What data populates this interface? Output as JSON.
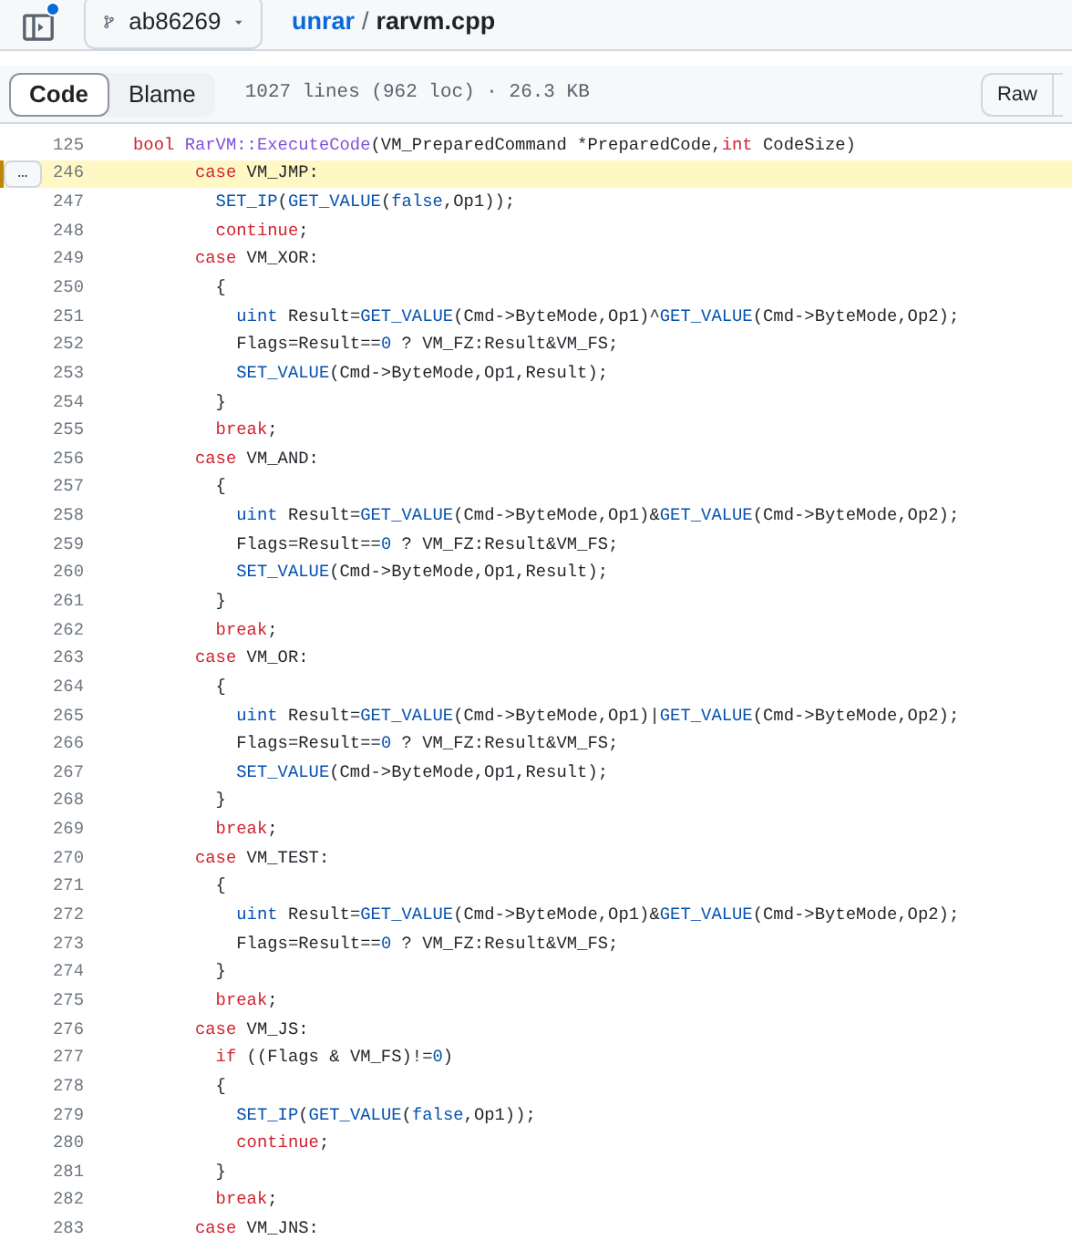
{
  "header": {
    "branch": "ab86269",
    "repo": "unrar",
    "separator": "/",
    "file": "rarvm.cpp",
    "notification": true
  },
  "toolbar": {
    "tabs": [
      {
        "label": "Code",
        "selected": true
      },
      {
        "label": "Blame",
        "selected": false
      }
    ],
    "info": "1027 lines (962 loc) · 26.3 KB",
    "raw_button": "Raw"
  },
  "code": {
    "lines": [
      {
        "number": "125",
        "highlighted": false,
        "tokens": [
          {
            "text": "bool",
            "kind": "keyword"
          },
          {
            "text": " RarVM::ExecuteCode",
            "kind": "entity"
          },
          {
            "text": "(VM_PreparedCommand *PreparedCode,",
            "kind": "plain"
          },
          {
            "text": "int",
            "kind": "keyword"
          },
          {
            "text": " CodeSize)",
            "kind": "plain"
          }
        ]
      },
      {
        "number": "246",
        "highlighted": true,
        "more_button": "…",
        "tokens": [
          {
            "text": "      case",
            "kind": "keyword"
          },
          {
            "text": " VM_JMP:",
            "kind": "plain"
          }
        ]
      },
      {
        "number": "247",
        "highlighted": false,
        "tokens": [
          {
            "text": "        SET_IP",
            "kind": "function"
          },
          {
            "text": "(",
            "kind": "plain"
          },
          {
            "text": "GET_VALUE",
            "kind": "function"
          },
          {
            "text": "(",
            "kind": "plain"
          },
          {
            "text": "false",
            "kind": "constant"
          },
          {
            "text": ",Op1));",
            "kind": "plain"
          }
        ]
      },
      {
        "number": "248",
        "highlighted": false,
        "tokens": [
          {
            "text": "        continue",
            "kind": "keyword"
          },
          {
            "text": ";",
            "kind": "plain"
          }
        ]
      },
      {
        "number": "249",
        "highlighted": false,
        "tokens": [
          {
            "text": "      case",
            "kind": "keyword"
          },
          {
            "text": " VM_XOR:",
            "kind": "plain"
          }
        ]
      },
      {
        "number": "250",
        "highlighted": false,
        "tokens": [
          {
            "text": "        {",
            "kind": "plain"
          }
        ]
      },
      {
        "number": "251",
        "highlighted": false,
        "tokens": [
          {
            "text": "          uint",
            "kind": "function"
          },
          {
            "text": " Result=",
            "kind": "plain"
          },
          {
            "text": "GET_VALUE",
            "kind": "function"
          },
          {
            "text": "(Cmd->ByteMode,Op1)^",
            "kind": "plain"
          },
          {
            "text": "GET_VALUE",
            "kind": "function"
          },
          {
            "text": "(Cmd->ByteMode,Op2);",
            "kind": "plain"
          }
        ]
      },
      {
        "number": "252",
        "highlighted": false,
        "tokens": [
          {
            "text": "          Flags=Result==",
            "kind": "plain"
          },
          {
            "text": "0",
            "kind": "constant"
          },
          {
            "text": " ? VM_FZ:Result&VM_FS;",
            "kind": "plain"
          }
        ]
      },
      {
        "number": "253",
        "highlighted": false,
        "tokens": [
          {
            "text": "          SET_VALUE",
            "kind": "function"
          },
          {
            "text": "(Cmd->ByteMode,Op1,Result);",
            "kind": "plain"
          }
        ]
      },
      {
        "number": "254",
        "highlighted": false,
        "tokens": [
          {
            "text": "        }",
            "kind": "plain"
          }
        ]
      },
      {
        "number": "255",
        "highlighted": false,
        "tokens": [
          {
            "text": "        break",
            "kind": "keyword"
          },
          {
            "text": ";",
            "kind": "plain"
          }
        ]
      },
      {
        "number": "256",
        "highlighted": false,
        "tokens": [
          {
            "text": "      case",
            "kind": "keyword"
          },
          {
            "text": " VM_AND:",
            "kind": "plain"
          }
        ]
      },
      {
        "number": "257",
        "highlighted": false,
        "tokens": [
          {
            "text": "        {",
            "kind": "plain"
          }
        ]
      },
      {
        "number": "258",
        "highlighted": false,
        "tokens": [
          {
            "text": "          uint",
            "kind": "function"
          },
          {
            "text": " Result=",
            "kind": "plain"
          },
          {
            "text": "GET_VALUE",
            "kind": "function"
          },
          {
            "text": "(Cmd->ByteMode,Op1)&",
            "kind": "plain"
          },
          {
            "text": "GET_VALUE",
            "kind": "function"
          },
          {
            "text": "(Cmd->ByteMode,Op2);",
            "kind": "plain"
          }
        ]
      },
      {
        "number": "259",
        "highlighted": false,
        "tokens": [
          {
            "text": "          Flags=Result==",
            "kind": "plain"
          },
          {
            "text": "0",
            "kind": "constant"
          },
          {
            "text": " ? VM_FZ:Result&VM_FS;",
            "kind": "plain"
          }
        ]
      },
      {
        "number": "260",
        "highlighted": false,
        "tokens": [
          {
            "text": "          SET_VALUE",
            "kind": "function"
          },
          {
            "text": "(Cmd->ByteMode,Op1,Result);",
            "kind": "plain"
          }
        ]
      },
      {
        "number": "261",
        "highlighted": false,
        "tokens": [
          {
            "text": "        }",
            "kind": "plain"
          }
        ]
      },
      {
        "number": "262",
        "highlighted": false,
        "tokens": [
          {
            "text": "        break",
            "kind": "keyword"
          },
          {
            "text": ";",
            "kind": "plain"
          }
        ]
      },
      {
        "number": "263",
        "highlighted": false,
        "tokens": [
          {
            "text": "      case",
            "kind": "keyword"
          },
          {
            "text": " VM_OR:",
            "kind": "plain"
          }
        ]
      },
      {
        "number": "264",
        "highlighted": false,
        "tokens": [
          {
            "text": "        {",
            "kind": "plain"
          }
        ]
      },
      {
        "number": "265",
        "highlighted": false,
        "tokens": [
          {
            "text": "          uint",
            "kind": "function"
          },
          {
            "text": " Result=",
            "kind": "plain"
          },
          {
            "text": "GET_VALUE",
            "kind": "function"
          },
          {
            "text": "(Cmd->ByteMode,Op1)|",
            "kind": "plain"
          },
          {
            "text": "GET_VALUE",
            "kind": "function"
          },
          {
            "text": "(Cmd->ByteMode,Op2);",
            "kind": "plain"
          }
        ]
      },
      {
        "number": "266",
        "highlighted": false,
        "tokens": [
          {
            "text": "          Flags=Result==",
            "kind": "plain"
          },
          {
            "text": "0",
            "kind": "constant"
          },
          {
            "text": " ? VM_FZ:Result&VM_FS;",
            "kind": "plain"
          }
        ]
      },
      {
        "number": "267",
        "highlighted": false,
        "tokens": [
          {
            "text": "          SET_VALUE",
            "kind": "function"
          },
          {
            "text": "(Cmd->ByteMode,Op1,Result);",
            "kind": "plain"
          }
        ]
      },
      {
        "number": "268",
        "highlighted": false,
        "tokens": [
          {
            "text": "        }",
            "kind": "plain"
          }
        ]
      },
      {
        "number": "269",
        "highlighted": false,
        "tokens": [
          {
            "text": "        break",
            "kind": "keyword"
          },
          {
            "text": ";",
            "kind": "plain"
          }
        ]
      },
      {
        "number": "270",
        "highlighted": false,
        "tokens": [
          {
            "text": "      case",
            "kind": "keyword"
          },
          {
            "text": " VM_TEST:",
            "kind": "plain"
          }
        ]
      },
      {
        "number": "271",
        "highlighted": false,
        "tokens": [
          {
            "text": "        {",
            "kind": "plain"
          }
        ]
      },
      {
        "number": "272",
        "highlighted": false,
        "tokens": [
          {
            "text": "          uint",
            "kind": "function"
          },
          {
            "text": " Result=",
            "kind": "plain"
          },
          {
            "text": "GET_VALUE",
            "kind": "function"
          },
          {
            "text": "(Cmd->ByteMode,Op1)&",
            "kind": "plain"
          },
          {
            "text": "GET_VALUE",
            "kind": "function"
          },
          {
            "text": "(Cmd->ByteMode,Op2);",
            "kind": "plain"
          }
        ]
      },
      {
        "number": "273",
        "highlighted": false,
        "tokens": [
          {
            "text": "          Flags=Result==",
            "kind": "plain"
          },
          {
            "text": "0",
            "kind": "constant"
          },
          {
            "text": " ? VM_FZ:Result&VM_FS;",
            "kind": "plain"
          }
        ]
      },
      {
        "number": "274",
        "highlighted": false,
        "tokens": [
          {
            "text": "        }",
            "kind": "plain"
          }
        ]
      },
      {
        "number": "275",
        "highlighted": false,
        "tokens": [
          {
            "text": "        break",
            "kind": "keyword"
          },
          {
            "text": ";",
            "kind": "plain"
          }
        ]
      },
      {
        "number": "276",
        "highlighted": false,
        "tokens": [
          {
            "text": "      case",
            "kind": "keyword"
          },
          {
            "text": " VM_JS:",
            "kind": "plain"
          }
        ]
      },
      {
        "number": "277",
        "highlighted": false,
        "tokens": [
          {
            "text": "        if",
            "kind": "keyword"
          },
          {
            "text": " ((Flags & VM_FS)!=",
            "kind": "plain"
          },
          {
            "text": "0",
            "kind": "constant"
          },
          {
            "text": ")",
            "kind": "plain"
          }
        ]
      },
      {
        "number": "278",
        "highlighted": false,
        "tokens": [
          {
            "text": "        {",
            "kind": "plain"
          }
        ]
      },
      {
        "number": "279",
        "highlighted": false,
        "tokens": [
          {
            "text": "          SET_IP",
            "kind": "function"
          },
          {
            "text": "(",
            "kind": "plain"
          },
          {
            "text": "GET_VALUE",
            "kind": "function"
          },
          {
            "text": "(",
            "kind": "plain"
          },
          {
            "text": "false",
            "kind": "constant"
          },
          {
            "text": ",Op1));",
            "kind": "plain"
          }
        ]
      },
      {
        "number": "280",
        "highlighted": false,
        "tokens": [
          {
            "text": "          continue",
            "kind": "keyword"
          },
          {
            "text": ";",
            "kind": "plain"
          }
        ]
      },
      {
        "number": "281",
        "highlighted": false,
        "tokens": [
          {
            "text": "        }",
            "kind": "plain"
          }
        ]
      },
      {
        "number": "282",
        "highlighted": false,
        "tokens": [
          {
            "text": "        break",
            "kind": "keyword"
          },
          {
            "text": ";",
            "kind": "plain"
          }
        ]
      },
      {
        "number": "283",
        "highlighted": false,
        "tokens": [
          {
            "text": "      case",
            "kind": "keyword"
          },
          {
            "text": " VM_JNS:",
            "kind": "plain"
          }
        ]
      }
    ]
  }
}
